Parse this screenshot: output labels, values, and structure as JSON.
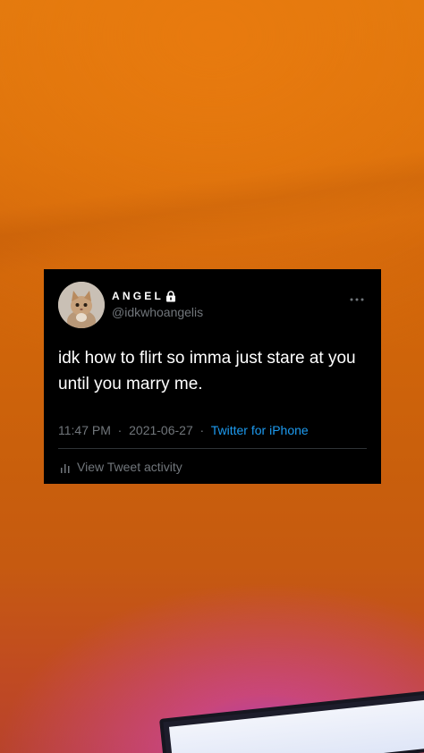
{
  "tweet": {
    "display_name": "ANGEL",
    "handle": "@idkwhoangelis",
    "text": "idk how to flirt so imma just stare at you until you marry me.",
    "time": "11:47 PM",
    "separator": "·",
    "date": "2021-06-27",
    "source": "Twitter for iPhone",
    "activity_label": "View Tweet activity",
    "icons": {
      "lock": "lock-icon",
      "more": "more-icon",
      "activity": "bar-chart-icon",
      "avatar": "kitten-avatar"
    }
  },
  "colors": {
    "card_background": "#000000",
    "primary_text": "#ffffff",
    "secondary_text": "#71767b",
    "link": "#1d9bf0",
    "background_orange": "#d0650a",
    "glow_purple": "#a83cc4"
  }
}
